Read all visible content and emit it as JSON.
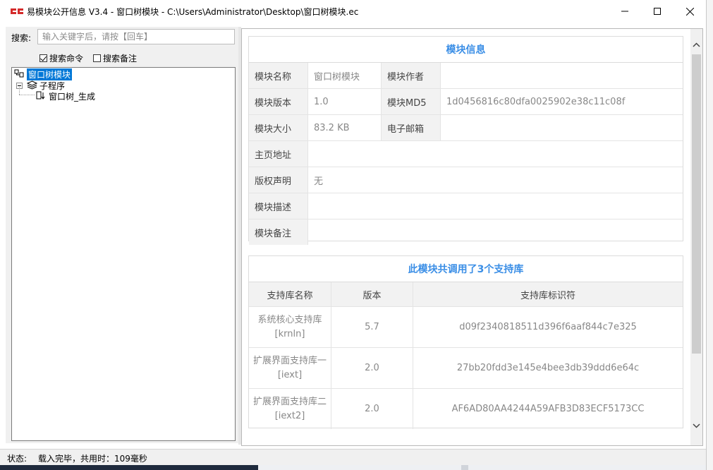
{
  "window": {
    "title": "易模块公开信息 V3.4 - 窗口树模块 - C:\\Users\\Administrator\\Desktop\\窗口树模块.ec"
  },
  "search": {
    "label": "搜索:",
    "placeholder": "输入关键字后，请按【回车】",
    "value": "",
    "options": [
      {
        "label": "搜索命令",
        "checked": true
      },
      {
        "label": "搜索备注",
        "checked": false
      }
    ]
  },
  "tree": {
    "root": {
      "label": "窗口树模块",
      "icon": "module-icon",
      "selected": true
    },
    "group": {
      "label": "子程序",
      "icon": "stack-icon",
      "expanded": true
    },
    "items": [
      {
        "label": "窗口树_生成",
        "icon": "subroutine-icon"
      }
    ]
  },
  "module_info": {
    "title": "模块信息",
    "rows": [
      [
        {
          "h": "模块名称",
          "v": "窗口树模块"
        },
        {
          "h": "模块作者",
          "v": ""
        }
      ],
      [
        {
          "h": "模块版本",
          "v": "1.0"
        },
        {
          "h": "模块MD5",
          "v": "1d0456816c80dfa0025902e38c11c08f"
        }
      ],
      [
        {
          "h": "模块大小",
          "v": "83.2 KB"
        },
        {
          "h": "电子邮箱",
          "v": ""
        }
      ],
      [
        {
          "h": "主页地址",
          "v": ""
        }
      ],
      [
        {
          "h": "版权声明",
          "v": "无"
        }
      ],
      [
        {
          "h": "模块描述",
          "v": ""
        }
      ],
      [
        {
          "h": "模块备注",
          "v": ""
        }
      ]
    ]
  },
  "libraries": {
    "title": "此模块共调用了3个支持库",
    "headers": [
      "支持库名称",
      "版本",
      "支持库标识符"
    ],
    "rows": [
      [
        "系统核心支持库[krnln]",
        "5.7",
        "d09f2340818511d396f6aaf844c7e325"
      ],
      [
        "扩展界面支持库一[iext]",
        "2.0",
        "27bb20fdd3e145e4bee3db39ddd6e64c"
      ],
      [
        "扩展界面支持库二[iext2]",
        "2.0",
        "AF6AD80AA4244A59AFB3D83ECF5173CC"
      ]
    ]
  },
  "status": {
    "label": "状态:",
    "text": "载入完毕，共用时：109毫秒"
  },
  "colors": {
    "accent": "#3a8ee6",
    "selection": "#0078d7"
  }
}
